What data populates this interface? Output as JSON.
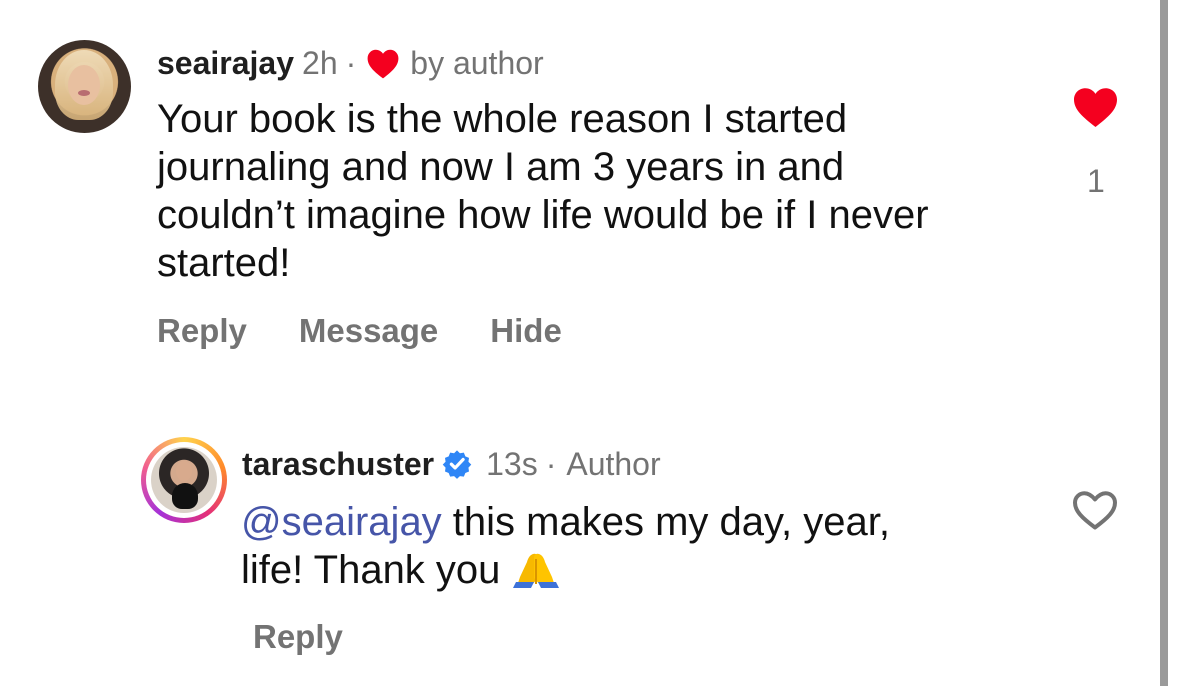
{
  "comments": [
    {
      "username": "seairajay",
      "time": "2h",
      "separator": "·",
      "author_like_label": "by author",
      "text": "Your book is the whole reason I started\njournaling and now I am 3 years in and\ncouldn’t imagine how life would be if I never\nstarted!",
      "actions": {
        "reply": "Reply",
        "message": "Message",
        "hide": "Hide"
      },
      "like_count": "1",
      "liked": true,
      "heart_color": "#f4001f"
    },
    {
      "username": "taraschuster",
      "time": "13s",
      "separator": "·",
      "role": "Author",
      "mention": "@seairajay",
      "text_after_mention": " this makes my day, year,\nlife! Thank you",
      "actions": {
        "reply": "Reply"
      },
      "liked": false,
      "verified_color": "#2f86f6"
    }
  ],
  "icons": {
    "liked_heart": "heart-filled-icon",
    "unliked_heart": "heart-outline-icon",
    "verified": "verified-badge-icon",
    "emoji": "folded-hands-emoji"
  }
}
